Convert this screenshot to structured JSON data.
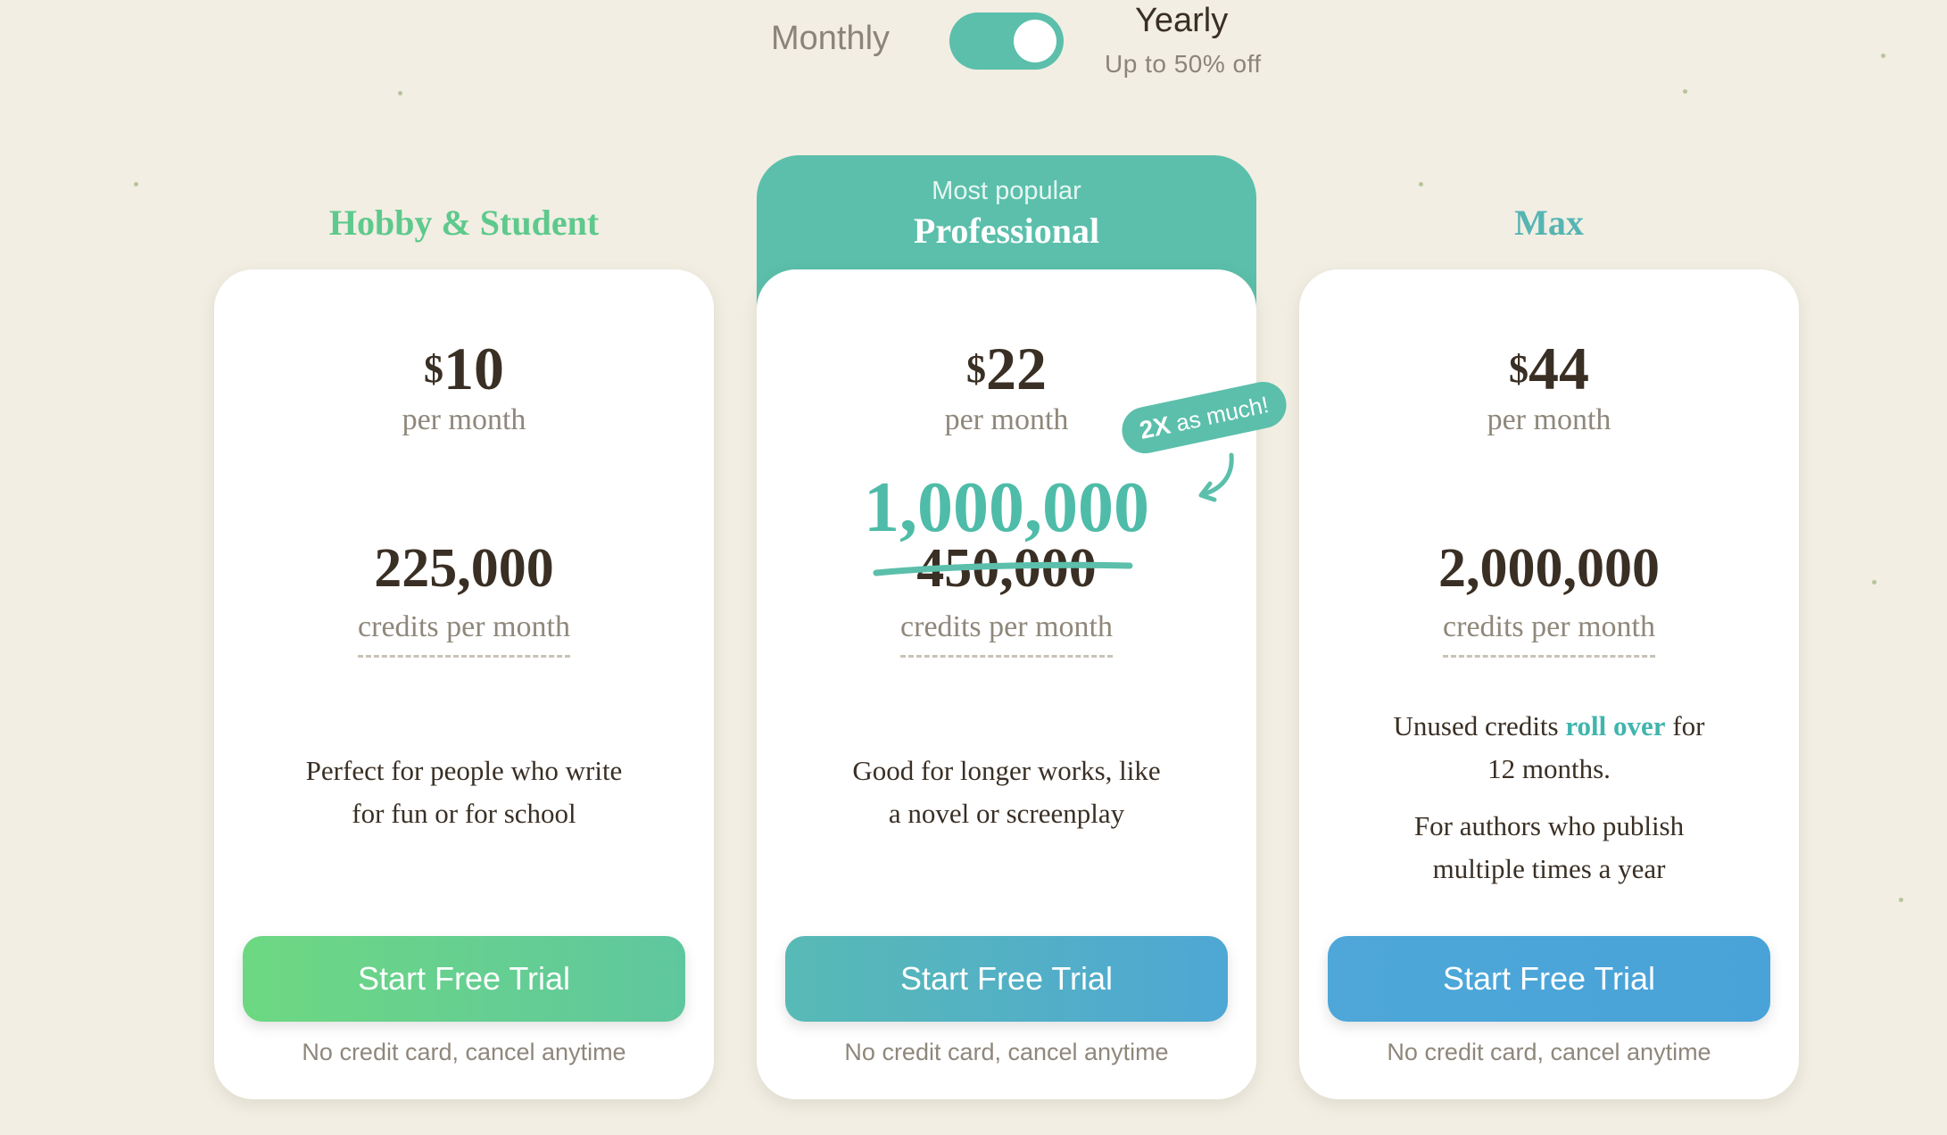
{
  "billing": {
    "monthly_label": "Monthly",
    "yearly_label": "Yearly",
    "yearly_discount": "Up to 50% off",
    "selected": "yearly",
    "accent": "#5bbfab"
  },
  "plans": [
    {
      "name": "Hobby & Student",
      "currency": "$",
      "price": "10",
      "period": "per month",
      "credits": "225,000",
      "credits_label": "credits per month",
      "description": [
        "Perfect for people who write",
        "for fun or for school"
      ],
      "cta": "Start Free Trial",
      "note": "No credit card, cancel anytime",
      "color": "#5ec98c"
    },
    {
      "badge": "Most popular",
      "name": "Professional",
      "currency": "$",
      "price": "22",
      "period": "per month",
      "credits": "1,000,000",
      "old_credits": "450,000",
      "callout_multiplier": "2X",
      "callout_text": "as much!",
      "credits_label": "credits per month",
      "description": [
        "Good for longer works, like",
        "a novel or screenplay"
      ],
      "cta": "Start Free Trial",
      "note": "No credit card, cancel anytime",
      "color": "#5bbfab"
    },
    {
      "name": "Max",
      "currency": "$",
      "price": "44",
      "period": "per month",
      "credits": "2,000,000",
      "credits_label": "credits per month",
      "rollover": {
        "prefix": "Unused credits",
        "highlight": "roll over",
        "suffix": "for",
        "line2": "12 months."
      },
      "description": [
        "For authors who publish",
        "multiple times a year"
      ],
      "cta": "Start Free Trial",
      "note": "No credit card, cancel anytime",
      "color": "#56b5b3"
    }
  ]
}
